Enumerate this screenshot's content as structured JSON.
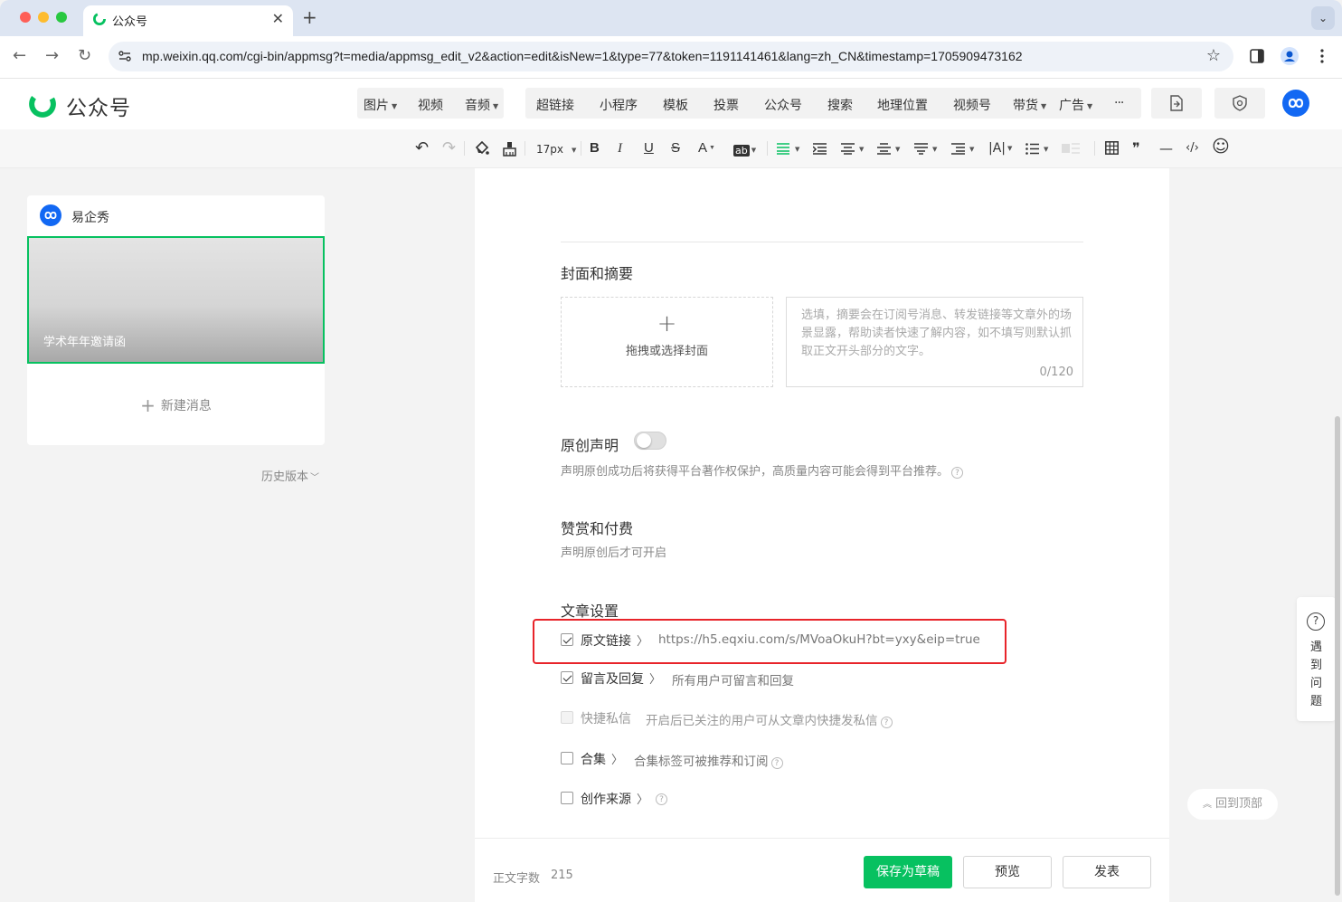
{
  "browser": {
    "tab_title": "公众号",
    "tab_close": "✕",
    "new_tab": "+",
    "tab_menu": "⌄",
    "url": "mp.weixin.qq.com/cgi-bin/appmsg?t=media/appmsg_edit_v2&action=edit&isNew=1&type=77&token=1191141461&lang=zh_CN&timestamp=1705909473162",
    "back": "←",
    "forward": "→",
    "reload": "↻",
    "bookmark": "☆"
  },
  "header": {
    "brand": "公众号",
    "menu_group_1": [
      {
        "label": "图片",
        "caret": "▼"
      },
      {
        "label": "视频",
        "caret": ""
      },
      {
        "label": "音频",
        "caret": "▼"
      }
    ],
    "menu_group_2": [
      {
        "label": "超链接",
        "caret": ""
      },
      {
        "label": "小程序",
        "caret": ""
      },
      {
        "label": "模板",
        "caret": ""
      },
      {
        "label": "投票",
        "caret": ""
      },
      {
        "label": "公众号",
        "caret": ""
      },
      {
        "label": "搜索",
        "caret": ""
      },
      {
        "label": "地理位置",
        "caret": ""
      },
      {
        "label": "视频号",
        "caret": ""
      },
      {
        "label": "带货",
        "caret": "▼"
      },
      {
        "label": "广告",
        "caret": "▼"
      },
      {
        "label": "···",
        "caret": ""
      }
    ]
  },
  "editor_toolbar": {
    "undo": "↶",
    "redo": "↷",
    "font_size": "17px",
    "bold": "B",
    "italic": "I",
    "underline": "U",
    "strike": "S",
    "font_color": "A",
    "bg_color": "ab",
    "letter_spacing": "|A|",
    "quote": "❞",
    "divider": "—",
    "code": "‹/›",
    "emoji": "☺",
    "caret": "▼"
  },
  "sidebar": {
    "account_name": "易企秀",
    "article_title": "学术年年邀请函",
    "new_message": "新建消息",
    "new_message_plus": "+",
    "history": "历史版本",
    "history_caret": "﹀"
  },
  "main": {
    "cover_section_title": "封面和摘要",
    "cover_plus": "+",
    "cover_text": "拖拽或选择封面",
    "summary_placeholder": "选填，摘要会在订阅号消息、转发链接等文章外的场景显露，帮助读者快速了解内容，如不填写则默认抓取正文开头部分的文字。",
    "summary_count": "0/120",
    "original_title": "原创声明",
    "original_desc": "声明原创成功后将获得平台著作权保护，高质量内容可能会得到平台推荐。",
    "reward_title": "赞赏和付费",
    "reward_desc": "声明原创后才可开启",
    "settings_title": "文章设置",
    "help_mark": "?",
    "arrow": "〉",
    "settings": {
      "source_link": {
        "label": "原文链接",
        "checked": true,
        "value": "https://h5.eqxiu.com/s/MVoaOkuH?bt=yxy&eip=true"
      },
      "comments": {
        "label": "留言及回复",
        "checked": true,
        "value": "所有用户可留言和回复"
      },
      "quick_message": {
        "label": "快捷私信",
        "checked": false,
        "disabled": true,
        "value": "开启后已关注的用户可从文章内快捷发私信"
      },
      "collection": {
        "label": "合集",
        "checked": false,
        "value": "合集标签可被推荐和订阅"
      },
      "creation_source": {
        "label": "创作来源",
        "checked": false,
        "value": ""
      }
    }
  },
  "bottom": {
    "wordcount_label": "正文字数",
    "wordcount": "215",
    "save_draft": "保存为草稿",
    "preview": "预览",
    "publish": "发表"
  },
  "float": {
    "help_icon": "?",
    "help_text": "遇到问题",
    "back_to_top": "回到顶部",
    "back_to_top_icon": "︽"
  },
  "colors": {
    "accent": "#07c160",
    "highlight_box": "#e8242a"
  }
}
